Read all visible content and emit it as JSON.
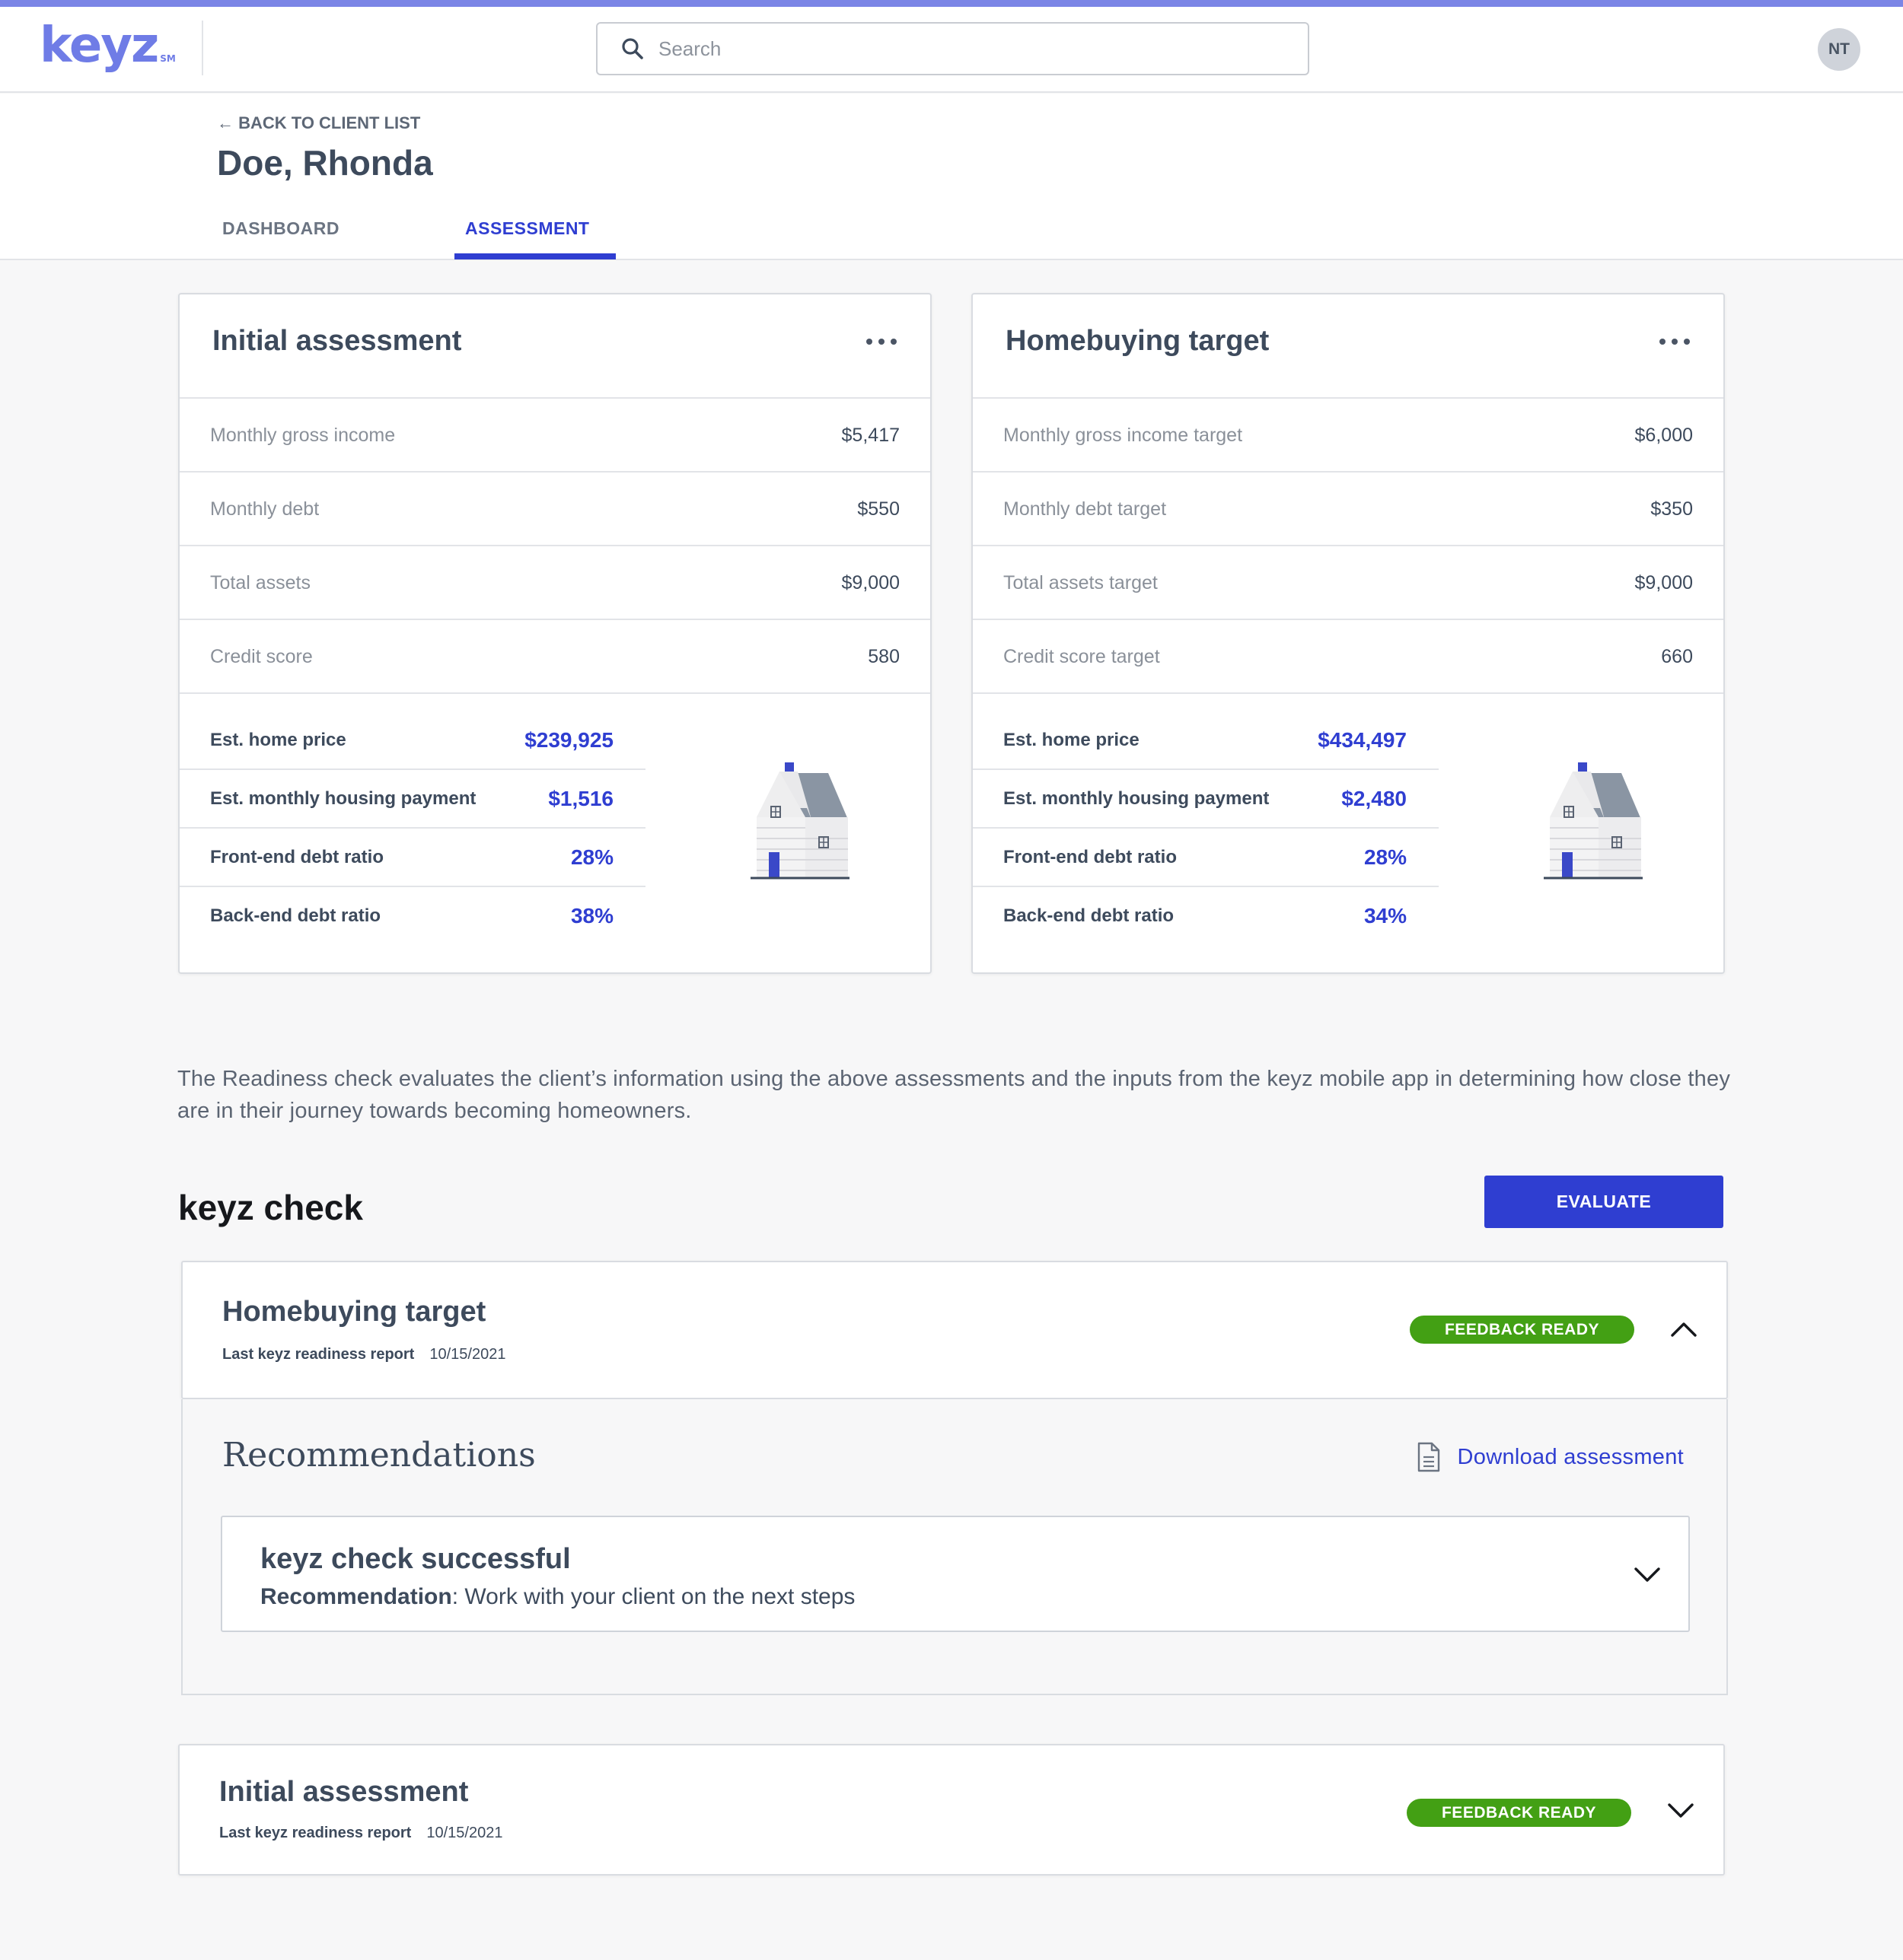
{
  "header": {
    "logo_text": "keyz",
    "logo_mark": "SM",
    "search_placeholder": "Search",
    "avatar_initials": "NT"
  },
  "page": {
    "back_link": "← BACK TO CLIENT LIST",
    "client_name": "Doe, Rhonda",
    "tabs": [
      {
        "label": "DASHBOARD",
        "active": false
      },
      {
        "label": "ASSESSMENT",
        "active": true
      }
    ]
  },
  "initial_assessment": {
    "title": "Initial assessment",
    "rows": [
      {
        "label": "Monthly gross income",
        "value": "$5,417"
      },
      {
        "label": "Monthly debt",
        "value": "$550"
      },
      {
        "label": "Total assets",
        "value": "$9,000"
      },
      {
        "label": "Credit score",
        "value": "580"
      }
    ],
    "estimates": [
      {
        "label": "Est. home price",
        "value": "$239,925"
      },
      {
        "label": "Est. monthly housing payment",
        "value": "$1,516"
      },
      {
        "label": "Front-end debt ratio",
        "value": "28%"
      },
      {
        "label": "Back-end debt ratio",
        "value": "38%"
      }
    ]
  },
  "homebuying_target": {
    "title": "Homebuying target",
    "rows": [
      {
        "label": "Monthly gross income target",
        "value": "$6,000"
      },
      {
        "label": "Monthly debt target",
        "value": "$350"
      },
      {
        "label": "Total assets target",
        "value": "$9,000"
      },
      {
        "label": "Credit score target",
        "value": "660"
      }
    ],
    "estimates": [
      {
        "label": "Est. home price",
        "value": "$434,497"
      },
      {
        "label": "Est. monthly housing payment",
        "value": "$2,480"
      },
      {
        "label": "Front-end debt ratio",
        "value": "28%"
      },
      {
        "label": "Back-end debt ratio",
        "value": "34%"
      }
    ]
  },
  "description": "The Readiness check evaluates the client’s information using the above assessments and the inputs from the keyz mobile app in determining how close they are in their journey towards becoming homeowners.",
  "keyz_check": {
    "title": "keyz check",
    "evaluate_label": "EVALUATE",
    "items": [
      {
        "title": "Homebuying target",
        "meta_label": "Last keyz readiness report",
        "date": "10/15/2021",
        "badge": "FEEDBACK READY",
        "expanded": true,
        "recommendations_title": "Recommendations",
        "download_label": "Download assessment",
        "result_title": "keyz check successful",
        "result_label": "Recommendation",
        "result_text": ": Work with your client on the next steps"
      },
      {
        "title": "Initial assessment",
        "meta_label": "Last keyz readiness report",
        "date": "10/15/2021",
        "badge": "FEEDBACK READY",
        "expanded": false
      }
    ]
  },
  "colors": {
    "accent": "#2f3ed1",
    "logo": "#6f7ce6",
    "badge_green": "#43a014",
    "text_dark": "#3d4a5c"
  },
  "icons": [
    "search-icon",
    "more-icon",
    "house-icon",
    "chevron-up-icon",
    "chevron-down-icon",
    "document-icon"
  ]
}
